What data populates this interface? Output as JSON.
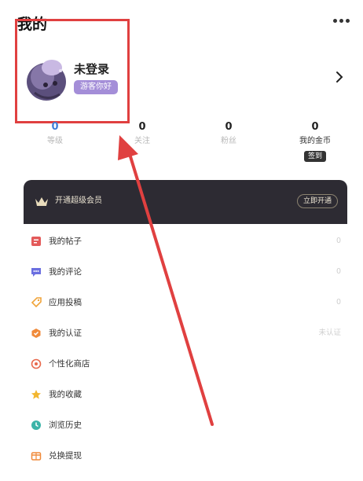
{
  "header": {
    "title": "我的",
    "more_icon": "more-dots-icon"
  },
  "profile": {
    "username": "未登录",
    "guest_badge": "游客你好",
    "avatar_icon": "cartoon-avatar-icon",
    "chevron_icon": "chevron-right-icon"
  },
  "stats": [
    {
      "value": "0",
      "label": "等级"
    },
    {
      "value": "0",
      "label": "关注"
    },
    {
      "value": "0",
      "label": "粉丝"
    },
    {
      "value": "0",
      "label": "我的金币",
      "action": "签到"
    }
  ],
  "vip": {
    "text": "开通超级会员",
    "button": "立即开通",
    "icon": "crown-icon"
  },
  "menu": [
    {
      "label": "我的帖子",
      "value": "0",
      "icon": "post-icon",
      "color": "#e35a5a"
    },
    {
      "label": "我的评论",
      "value": "0",
      "icon": "comment-icon",
      "color": "#6b6fe0"
    },
    {
      "label": "应用投稿",
      "value": "0",
      "icon": "submit-icon",
      "color": "#f0a43a"
    },
    {
      "label": "我的认证",
      "value": "未认证",
      "icon": "verify-icon",
      "color": "#f08a3a"
    },
    {
      "label": "个性化商店",
      "value": "",
      "icon": "store-icon",
      "color": "#e8694d"
    },
    {
      "label": "我的收藏",
      "value": "",
      "icon": "favorite-icon",
      "color": "#f2b630"
    },
    {
      "label": "浏览历史",
      "value": "",
      "icon": "history-icon",
      "color": "#3cb4a8"
    },
    {
      "label": "兑换提现",
      "value": "",
      "icon": "exchange-icon",
      "color": "#f08a3a"
    }
  ],
  "annotation": {
    "color": "#e04040"
  }
}
